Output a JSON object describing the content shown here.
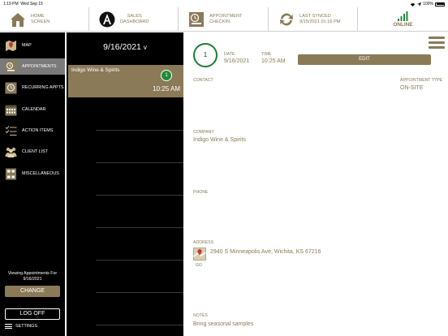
{
  "status": {
    "time": "1:19 PM",
    "date": "Wed Sep 15",
    "battery": "100%"
  },
  "topnav": {
    "home": {
      "line1": "HOME",
      "line2": "SCREEN"
    },
    "sales": {
      "line1": "SALES",
      "line2": "DASHBOARD"
    },
    "appointment": {
      "line1": "APPOINTMENT",
      "line2": "CHECKIN"
    },
    "sync": {
      "line1": "LAST SYNCED",
      "line2": "9/15/2021 01:16 PM"
    },
    "online": "ONLINE"
  },
  "sidebar": {
    "items": [
      {
        "label": "MAP"
      },
      {
        "label": "APPOINTMENTS"
      },
      {
        "label": "RECURRING APPTS"
      },
      {
        "label": "CALENDAR"
      },
      {
        "label": "ACTION ITEMS"
      },
      {
        "label": "CLIENT LIST"
      },
      {
        "label": "MISCELLANEOUS"
      }
    ],
    "viewing_line1": "Viewing Appointments For",
    "viewing_date": "9/16/2021",
    "change_label": "CHANGE",
    "logoff_label": "LOG OFF",
    "settings_label": "SETTINGS"
  },
  "list": {
    "date": "9/16/2021",
    "chevron": "v",
    "appointment": {
      "company": "Indigo Wine & Spirits",
      "number": "1",
      "time": "10:25 AM"
    }
  },
  "detail": {
    "number": "1",
    "date_label": "DATE",
    "date_value": "9/16/2021",
    "time_label": "TIME",
    "time_value": "10:25 AM",
    "edit_label": "EDIT",
    "contact_label": "CONTACT",
    "appt_type_label": "APPOINTMENT TYPE",
    "appt_type_value": "ON-SITE",
    "company_label": "COMPANY",
    "company_value": "Indigo Wine & Spirits",
    "phone_label": "PHONE",
    "address_label": "ADDRESS",
    "address_value": "2940 S Minneapolis Ave, Wichita, KS 67216",
    "go_label": "GO",
    "notes_label": "NOTES",
    "notes_value": "Bring seasonal samples"
  },
  "colors": {
    "accent": "#8a7a57",
    "online": "#1f8a3a",
    "sidebar_bg": "#000000",
    "active_item": "#7a7a7a"
  }
}
